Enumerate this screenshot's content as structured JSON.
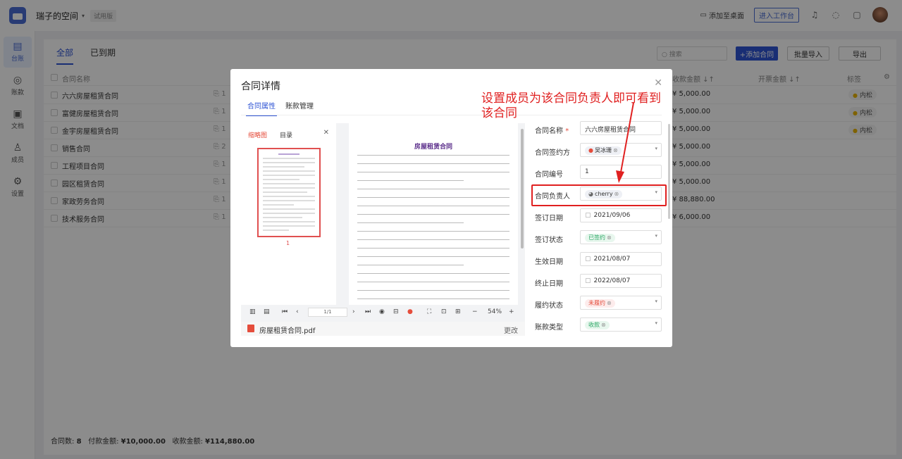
{
  "topbar": {
    "space_name": "瑞子的空间",
    "space_caret": "▾",
    "trial": "试用版",
    "add_desktop": "添加至桌面",
    "enter_workspace": "进入工作台"
  },
  "leftnav": [
    {
      "label": "台账",
      "icon": "ledger-icon",
      "glyph": "▤"
    },
    {
      "label": "账款",
      "icon": "money-icon",
      "glyph": "◎"
    },
    {
      "label": "文档",
      "icon": "document-icon",
      "glyph": "▣"
    },
    {
      "label": "成员",
      "icon": "member-icon",
      "glyph": "♙"
    },
    {
      "label": "设置",
      "icon": "settings-icon",
      "glyph": "⚙"
    }
  ],
  "main": {
    "tabs": [
      "全部",
      "已到期"
    ],
    "search_placeholder": "搜索",
    "add_button": "+添加合同",
    "import_button": "批量导入",
    "export_button": "导出",
    "columns": {
      "name": "合同名称",
      "receive": "收款金额 ↓↑",
      "pay": "开票金额 ↓↑",
      "tags": "标签"
    },
    "rows": [
      {
        "name": "六六房屋租赁合同",
        "clip": "1",
        "amount": "¥ 5,000.00",
        "tag": "内松"
      },
      {
        "name": "富健房屋租赁合同",
        "clip": "1",
        "amount": "¥ 5,000.00",
        "tag": "内松"
      },
      {
        "name": "金宇房屋租赁合同",
        "clip": "1",
        "amount": "¥ 5,000.00",
        "tag": "内松"
      },
      {
        "name": "销售合同",
        "clip": "2",
        "amount": "¥ 5,000.00",
        "tag": ""
      },
      {
        "name": "工程项目合同",
        "clip": "1",
        "amount": "¥ 5,000.00",
        "tag": ""
      },
      {
        "name": "园区租赁合同",
        "clip": "1",
        "amount": "¥ 5,000.00",
        "tag": ""
      },
      {
        "name": "家政劳务合同",
        "clip": "1",
        "amount": "¥ 88,880.00",
        "tag": ""
      },
      {
        "name": "技术服务合同",
        "clip": "1",
        "amount": "¥ 6,000.00",
        "tag": ""
      }
    ],
    "footer": {
      "count_label": "合同数:",
      "count": "8",
      "pay_label": "付款金额:",
      "pay": "¥10,000.00",
      "receive_label": "收款金额:",
      "receive": "¥114,880.00"
    }
  },
  "modal": {
    "title": "合同详情",
    "tabs": [
      "合同属性",
      "账款管理"
    ],
    "viewer": {
      "thumb_tab": "缩略图",
      "toc_tab": "目录",
      "page_number": "1",
      "doc_title": "房屋租赁合同",
      "page_field": "1/1",
      "zoom": "54%",
      "file_name": "房屋租赁合同.pdf",
      "change": "更改"
    },
    "fields": {
      "name": {
        "label": "合同名称",
        "required": "*",
        "value": "六六房屋租赁合同"
      },
      "party": {
        "label": "合同签约方",
        "value": "吴冰珊"
      },
      "number": {
        "label": "合同编号",
        "value": "1"
      },
      "owner": {
        "label": "合同负责人",
        "value": "cherry"
      },
      "sign_date": {
        "label": "签订日期",
        "value": "2021/09/06"
      },
      "sign_status": {
        "label": "签订状态",
        "value": "已签约"
      },
      "start_date": {
        "label": "生效日期",
        "value": "2021/08/07"
      },
      "end_date": {
        "label": "终止日期",
        "value": "2022/08/07"
      },
      "perform_status": {
        "label": "履约状态",
        "value": "未履约"
      },
      "account_type": {
        "label": "账款类型",
        "value": "收款"
      }
    }
  },
  "annotation": "设置成员为该合同负责人即可看到该合同",
  "colors": {
    "accent": "#2f54d4",
    "highlight": "#e02020",
    "signed": "#2aa764"
  }
}
